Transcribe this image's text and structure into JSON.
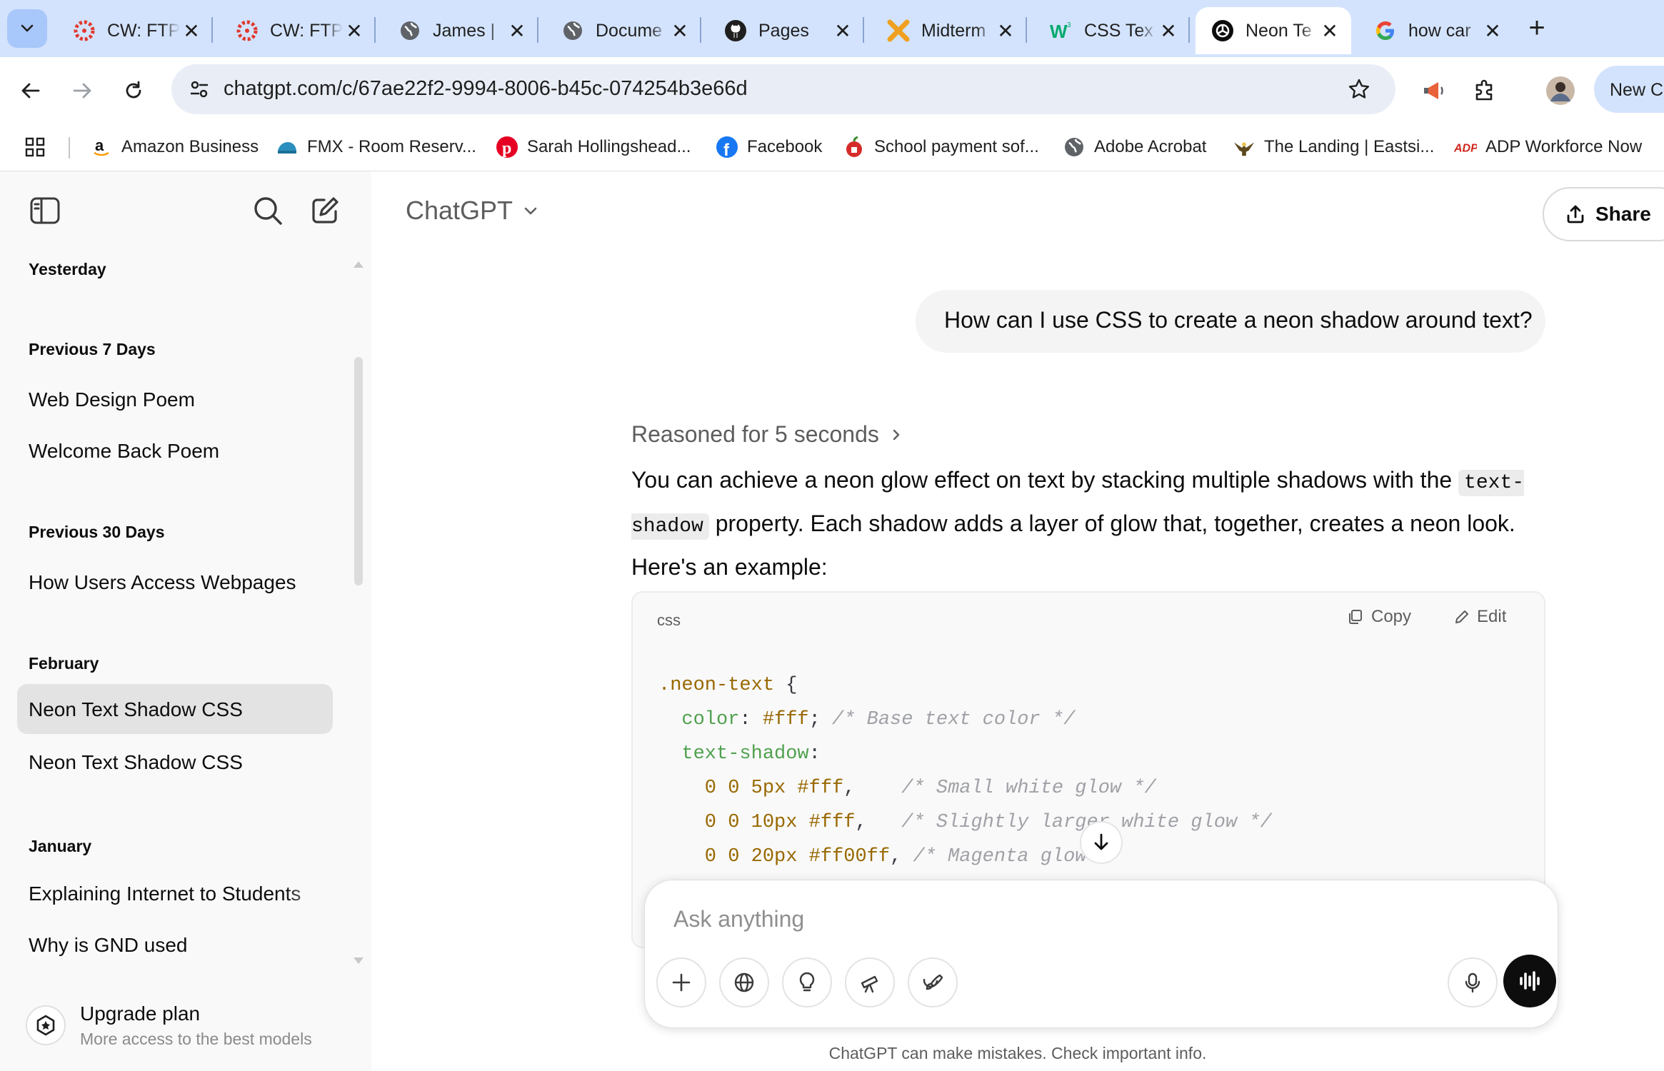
{
  "browser": {
    "tabs": [
      {
        "title": "CW: FTP",
        "icon": "canvas-red-icon"
      },
      {
        "title": "CW: FTP",
        "icon": "canvas-red-icon"
      },
      {
        "title": "James | ",
        "icon": "globe-icon"
      },
      {
        "title": "Docume",
        "icon": "globe-icon"
      },
      {
        "title": "Pages",
        "icon": "github-icon"
      },
      {
        "title": "Midterm",
        "icon": "cross-orange-icon"
      },
      {
        "title": "CSS Tex",
        "icon": "w3schools-icon"
      },
      {
        "title": "Neon Te",
        "icon": "openai-icon",
        "active": true
      },
      {
        "title": "how car",
        "icon": "google-icon"
      }
    ],
    "url": "chatgpt.com/c/67ae22f2-9994-8006-b45c-074254b3e66d",
    "new_chat_label": "New Ch",
    "bookmarks": [
      {
        "label": "Amazon Business",
        "icon": "amazon-icon"
      },
      {
        "label": "FMX - Room Reserv...",
        "icon": "fmx-icon"
      },
      {
        "label": "Sarah Hollingshead...",
        "icon": "pinterest-icon"
      },
      {
        "label": "Facebook",
        "icon": "facebook-icon"
      },
      {
        "label": "School payment sof...",
        "icon": "apple-icon"
      },
      {
        "label": "Adobe Acrobat",
        "icon": "globe-icon"
      },
      {
        "label": "The Landing | Eastsi...",
        "icon": "eagle-icon"
      },
      {
        "label": "ADP Workforce Now",
        "icon": "adp-icon"
      }
    ]
  },
  "sidebar": {
    "groups": [
      {
        "label": "Yesterday",
        "items": []
      },
      {
        "label": "Previous 7 Days",
        "items": [
          "Web Design Poem",
          "Welcome Back Poem"
        ]
      },
      {
        "label": "Previous 30 Days",
        "items": [
          "How Users Access Webpages"
        ]
      },
      {
        "label": "February",
        "items": [
          "Neon Text Shadow CSS",
          "Neon Text Shadow CSS"
        ]
      },
      {
        "label": "January",
        "items": [
          "Explaining Internet to Students",
          "Why is GND used"
        ]
      }
    ],
    "upgrade_title": "Upgrade plan",
    "upgrade_subtitle": "More access to the best models"
  },
  "header": {
    "model": "ChatGPT",
    "share_label": "Share"
  },
  "chat": {
    "user_message": "How can I use CSS to create a neon shadow around text?",
    "reasoned": "Reasoned for 5 seconds",
    "answer_part1": "You can achieve a neon glow effect on text by stacking multiple shadows with the ",
    "answer_code": "text-shadow",
    "answer_part2": " property. Each shadow adds a layer of glow that, together, creates a neon look. Here's an example:",
    "code": {
      "lang": "css",
      "copy_label": "Copy",
      "edit_label": "Edit",
      "lines": [
        [
          {
            "t": ".neon-text",
            "c": "sel"
          },
          {
            "t": " {",
            "c": "pun"
          }
        ],
        [
          {
            "t": "  color",
            "c": "prop"
          },
          {
            "t": ": ",
            "c": "pun"
          },
          {
            "t": "#fff",
            "c": "val"
          },
          {
            "t": "; ",
            "c": "pun"
          },
          {
            "t": "/* Base text color */",
            "c": "cmt"
          }
        ],
        [
          {
            "t": "  text-shadow",
            "c": "prop"
          },
          {
            "t": ":",
            "c": "pun"
          }
        ],
        [
          {
            "t": "    0 0 5px #fff",
            "c": "val"
          },
          {
            "t": ",    ",
            "c": "pun"
          },
          {
            "t": "/* Small white glow */",
            "c": "cmt"
          }
        ],
        [
          {
            "t": "    0 0 10px #fff",
            "c": "val"
          },
          {
            "t": ",   ",
            "c": "pun"
          },
          {
            "t": "/* Slightly larger white glow */",
            "c": "cmt"
          }
        ],
        [
          {
            "t": "    0 0 20px #ff00ff",
            "c": "val"
          },
          {
            "t": ", ",
            "c": "pun"
          },
          {
            "t": "/* Magenta glow */",
            "c": "cmt"
          }
        ]
      ]
    }
  },
  "composer": {
    "placeholder": "Ask anything",
    "tools": [
      "plus-icon",
      "globe-icon",
      "lightbulb-icon",
      "telescope-icon",
      "paintbrush-icon"
    ]
  },
  "disclaimer": "ChatGPT can make mistakes. Check important info."
}
